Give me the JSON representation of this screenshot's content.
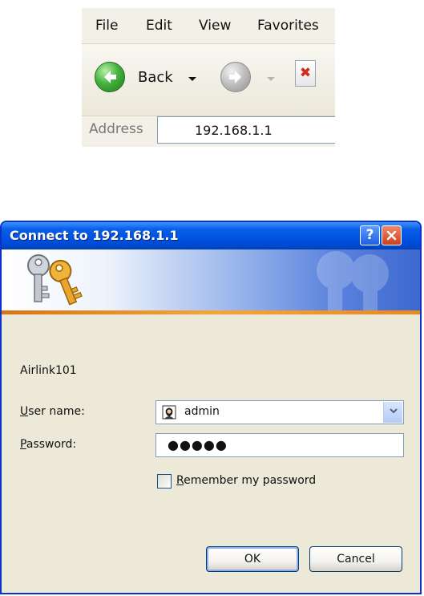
{
  "browser": {
    "menu": [
      "File",
      "Edit",
      "View",
      "Favorites"
    ],
    "back_label": "Back",
    "address_label": "Address",
    "address_value": "192.168.1.1",
    "icons": {
      "back": "green-back-arrow-icon",
      "forward": "gray-forward-arrow-icon",
      "stop": "red-x-stop-icon"
    }
  },
  "dialog": {
    "title": "Connect to 192.168.1.1",
    "help_button": "?",
    "close_button": "X",
    "realm": "Airlink101",
    "username": {
      "label_accesskey": "U",
      "label_rest": "ser name:",
      "value": "admin"
    },
    "password": {
      "label_accesskey": "P",
      "label_rest": "assword:",
      "value_masked": "●●●●●"
    },
    "remember": {
      "label_accesskey": "R",
      "label_rest": "emember my password",
      "checked": false
    },
    "ok_label": "OK",
    "cancel_label": "Cancel",
    "icons": {
      "banner": "keys-icon",
      "user": "user-icon",
      "combo": "chevron-down-icon"
    },
    "colors": {
      "titlebar": "#0052e0",
      "banner_stripe": "#f6a43a",
      "body": "#ece9d8"
    }
  }
}
